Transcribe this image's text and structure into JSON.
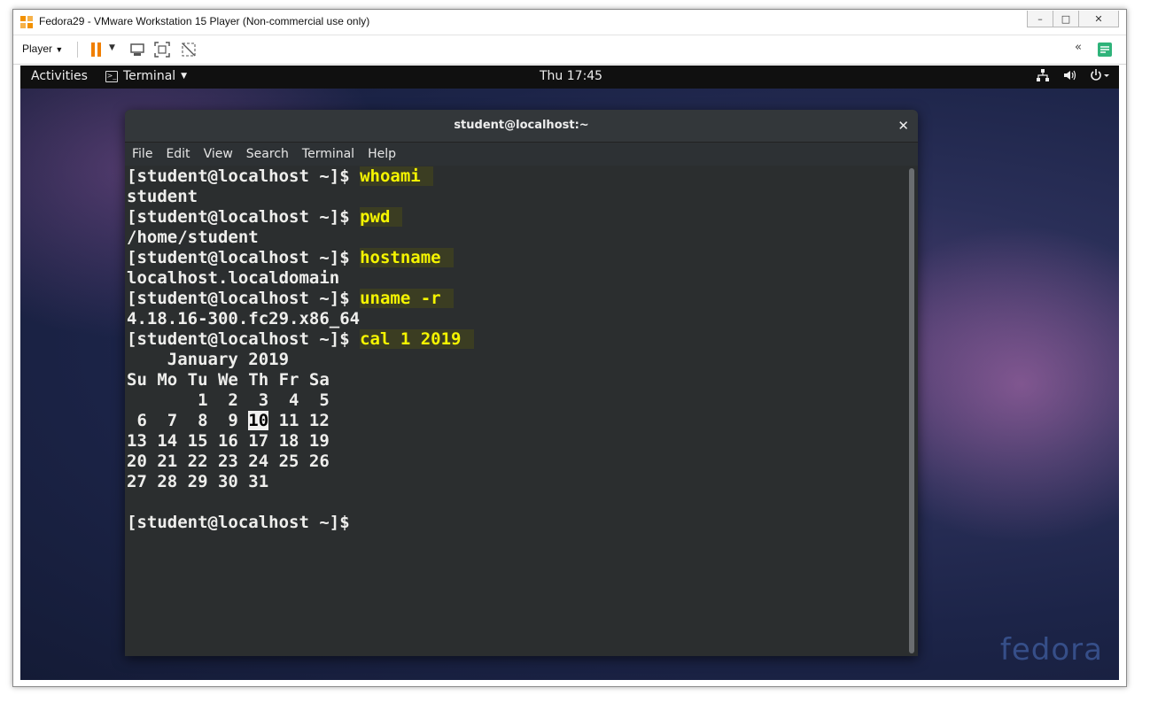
{
  "vmware": {
    "title": "Fedora29 - VMware Workstation 15 Player (Non-commercial use only)",
    "player_menu": "Player",
    "chevron": "«",
    "win_min": "–",
    "win_max": "□",
    "win_close": "✕"
  },
  "gnome": {
    "activities": "Activities",
    "app_menu": "Terminal",
    "clock": "Thu 17:45",
    "tray_icons": [
      "network-icon",
      "volume-icon",
      "power-icon"
    ]
  },
  "terminal": {
    "title": "student@localhost:~",
    "close": "✕",
    "menu": [
      "File",
      "Edit",
      "View",
      "Search",
      "Terminal",
      "Help"
    ],
    "prompt": "[student@localhost ~]$ ",
    "lines": [
      {
        "type": "cmd",
        "text": "whoami"
      },
      {
        "type": "out",
        "text": "student"
      },
      {
        "type": "cmd",
        "text": "pwd"
      },
      {
        "type": "out",
        "text": "/home/student"
      },
      {
        "type": "cmd",
        "text": "hostname"
      },
      {
        "type": "out",
        "text": "localhost.localdomain"
      },
      {
        "type": "cmd",
        "text": "uname -r"
      },
      {
        "type": "out",
        "text": "4.18.16-300.fc29.x86_64"
      },
      {
        "type": "cmd",
        "text": "cal 1 2019"
      },
      {
        "type": "out",
        "text": "    January 2019"
      },
      {
        "type": "out",
        "text": "Su Mo Tu We Th Fr Sa"
      },
      {
        "type": "out",
        "text": "       1  2  3  4  5"
      },
      {
        "type": "cal",
        "before": " 6  7  8  9 ",
        "highlight": "10",
        "after": " 11 12"
      },
      {
        "type": "out",
        "text": "13 14 15 16 17 18 19"
      },
      {
        "type": "out",
        "text": "20 21 22 23 24 25 26"
      },
      {
        "type": "out",
        "text": "27 28 29 30 31"
      },
      {
        "type": "out",
        "text": ""
      },
      {
        "type": "prompt",
        "text": ""
      }
    ]
  },
  "wallpaper": {
    "watermark": "fedora"
  },
  "colors": {
    "terminal_bg": "#2b2e2f",
    "command_highlight": "#f5f500",
    "topbar_bg": "#101010"
  }
}
